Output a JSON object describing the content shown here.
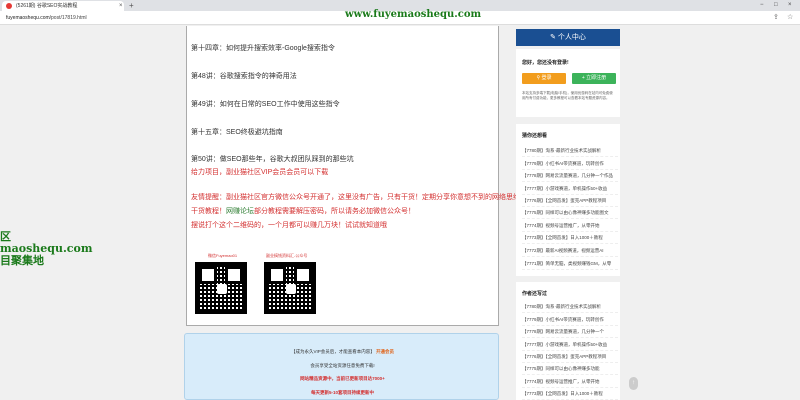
{
  "browser": {
    "tab_title": "(5261期) 谷歌SEO实战教程",
    "tab_close": "×",
    "new_tab": "+",
    "url_host": "fuyemaoshequ.com",
    "url_path": "/post/17819.html",
    "watermark": "www.fuyemaoshequ.com",
    "win_min": "−",
    "win_max": "□",
    "win_close": "×"
  },
  "overlay": {
    "line1": "区",
    "line2": "maoshequ.com",
    "line3": "目聚集地"
  },
  "article": {
    "lines": [
      "第十四章：如何提升搜索效率-Google搜索指令",
      "第48讲：谷歌搜索指令的神奇用法",
      "第49讲：如何在日常的SEO工作中使用这些指令",
      "第十五章：SEO终极避坑指南",
      "第50讲：做SEO那些年，谷歌大叔团队踩到的那些坑"
    ],
    "red_line": "给力项目，副业猫社区VIP会员会员可以下载",
    "hint_prefix": "友情提醒：副业猫社区官方微信公众号开通了，这里没有广告，只有干货！定期分享你意想不到的网络思维！",
    "hint_part2a": "干货教程！",
    "hint_link": "网赚论坛",
    "hint_part2b": "部分教程需要解压密码，所以请务必加微信公众号！",
    "hint_line3": "摆说打个这个二维码的，一个月都可以赚几万块！试试就知道哦",
    "qr1_label": "微信Fuyemao01",
    "qr2_label": "副业搞钱资料汇-公众号"
  },
  "vip": {
    "line1_a": "【成为永久VIP会员后，才能查看本内容】",
    "line1_b": "开通会员",
    "line2": "会员享受全站资源任意免费下载!",
    "line3": "网站精品资源中，当前已更新项目达7000+",
    "line4": "每天更新5-10套项目持续更新中"
  },
  "sidebar": {
    "header": "个人中心",
    "greet": "您好，您还没有登录!",
    "login": "登录",
    "register": "立即注册",
    "note": "本站支持多端下载(电脑/手机)，使用优惠码在站内可免费使用所有付费功能，更多教程可以查看本站专题资源内容。",
    "latest_title": "猜你还想看",
    "latest": [
      "【7780期】淘系·最新行业技术实战解析",
      "【7779期】小红书AI带货赛道，玩转创作",
      "【7778期】网易云流量赛道，几分钟一个作品",
      "【7777期】小游戏赛道，单机操作50+收益",
      "【7776期】【全网首发】蛋克APP教程项目",
      "【7775期】同样可以由心像神赚多功能图文",
      "【7774期】视频号运营推广，从零开始",
      "【7773期】【全网首发】日入1000＋教程",
      "【7772期】最新AI视频赛道，视频运营AI",
      "【7771期】简单无脑，类视频赚钱GM，从零"
    ],
    "recommend_title": "作者还写过",
    "recommend": [
      "【7780期】淘系·最新行业技术实战解析",
      "【7779期】小红书AI带货赛道，玩转创作",
      "【7778期】网易云流量赛道，几分钟一个",
      "【7777期】小游戏赛道，单机操作50+收益",
      "【7776期】【全网首发】蛋克APP教程项目",
      "【7775期】同样可以由心像神赚多功能",
      "【7774期】视频号运营推广，从零开始",
      "【7773期】【全网首发】日入1000＋教程"
    ]
  }
}
